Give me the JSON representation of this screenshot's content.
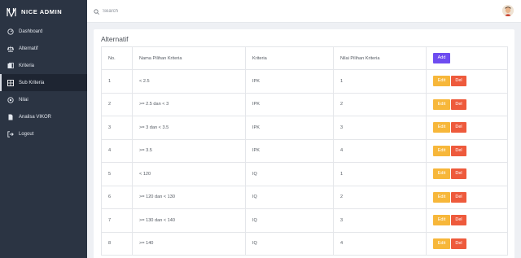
{
  "app": {
    "brand": "NICE ADMIN"
  },
  "nav": {
    "items": [
      {
        "label": "Dashboard",
        "icon": "dashboard-icon",
        "active": false
      },
      {
        "label": "Alternatif",
        "icon": "scale-icon",
        "active": false
      },
      {
        "label": "Kriteria",
        "icon": "list-icon",
        "active": false
      },
      {
        "label": "Sub Kriteria",
        "icon": "grid-icon",
        "active": true
      },
      {
        "label": "Nilai",
        "icon": "record-icon",
        "active": false
      },
      {
        "label": "Analisa VIKOR",
        "icon": "document-icon",
        "active": false
      },
      {
        "label": "Logout",
        "icon": "logout-icon",
        "active": false
      }
    ]
  },
  "search": {
    "placeholder": "Search",
    "value": ""
  },
  "colors": {
    "sidebar": "#2b3443",
    "add": "#6e4cf0",
    "edit": "#f7b73a",
    "delete": "#ee5a3c"
  },
  "card": {
    "title": "Alternatif"
  },
  "table": {
    "headers": [
      "No.",
      "Nama Pilihan Kriteria",
      "Kriteria",
      "Nilai Pilihan Kriteria"
    ],
    "add_label": "Add",
    "edit_label": "Edit",
    "delete_label": "Del",
    "rows": [
      {
        "no": "1",
        "nama": "< 2.5",
        "kriteria": "IPK",
        "nilai": "1"
      },
      {
        "no": "2",
        "nama": ">= 2.5 dan < 3",
        "kriteria": "IPK",
        "nilai": "2"
      },
      {
        "no": "3",
        "nama": ">= 3 dan < 3.5",
        "kriteria": "IPK",
        "nilai": "3"
      },
      {
        "no": "4",
        "nama": ">= 3.5",
        "kriteria": "IPK",
        "nilai": "4"
      },
      {
        "no": "5",
        "nama": "< 120",
        "kriteria": "IQ",
        "nilai": "1"
      },
      {
        "no": "6",
        "nama": ">= 120 dan < 130",
        "kriteria": "IQ",
        "nilai": "2"
      },
      {
        "no": "7",
        "nama": ">= 130 dan < 140",
        "kriteria": "IQ",
        "nilai": "3"
      },
      {
        "no": "8",
        "nama": ">= 140",
        "kriteria": "IQ",
        "nilai": "4"
      }
    ]
  }
}
